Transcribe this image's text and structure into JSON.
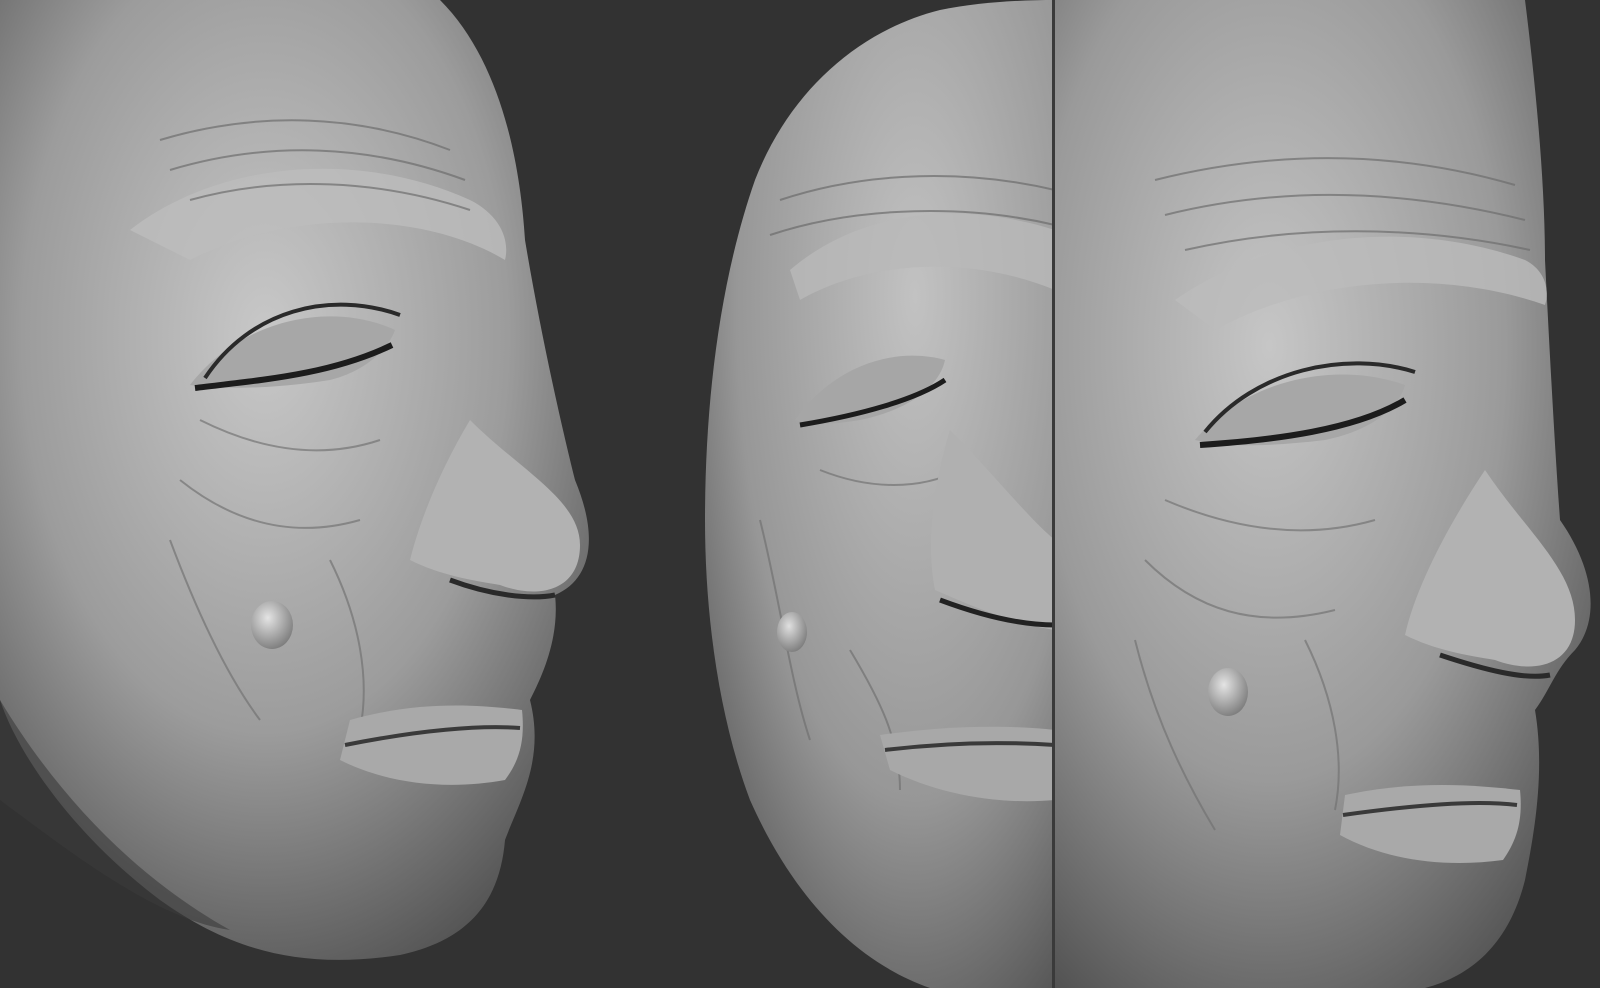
{
  "scene": {
    "description_type": "sculpt-render-triptych",
    "background_color": "#323232",
    "material_color": "#9a9a9a",
    "highlight_color": "#d8d8d8",
    "shadow_color": "#1e1e1e",
    "views": [
      {
        "id": "view-left",
        "subject": "face-sculpt",
        "angle": "profile-right"
      },
      {
        "id": "view-mid",
        "subject": "face-sculpt",
        "angle": "three-quarter"
      },
      {
        "id": "view-right",
        "subject": "face-sculpt",
        "angle": "profile-right"
      }
    ]
  }
}
